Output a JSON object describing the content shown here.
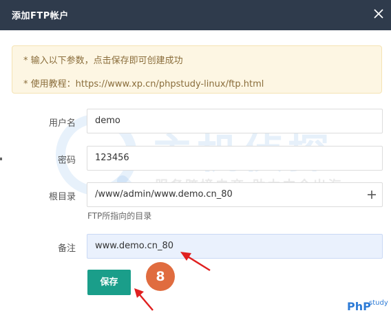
{
  "dialog": {
    "title": "添加FTP帐户"
  },
  "notice": {
    "line1": "* 输入以下参数，点击保存即可创建成功",
    "line2": "* 使用教程：https://www.xp.cn/phpstudy-linux/ftp.html"
  },
  "form": {
    "username_label": "用户名",
    "username_value": "demo",
    "password_label": "密码",
    "password_value": "123456",
    "root_label": "根目录",
    "root_value": "/www/admin/www.demo.cn_80",
    "root_hint": "FTP所指向的目录",
    "note_label": "备注",
    "note_value": "www.demo.cn_80"
  },
  "actions": {
    "save_label": "保存"
  },
  "annotation": {
    "step_number": "8"
  },
  "watermark": {
    "main_text": "主机侦探",
    "sub_text": "服务跨境电商 助力中企出海"
  },
  "logo": {
    "php": "PhP",
    "study": "study"
  },
  "colors": {
    "titlebar": "#2f3b4c",
    "accent": "#1a9e8a",
    "annotation": "#e06c3f",
    "arrow": "#e02020"
  }
}
